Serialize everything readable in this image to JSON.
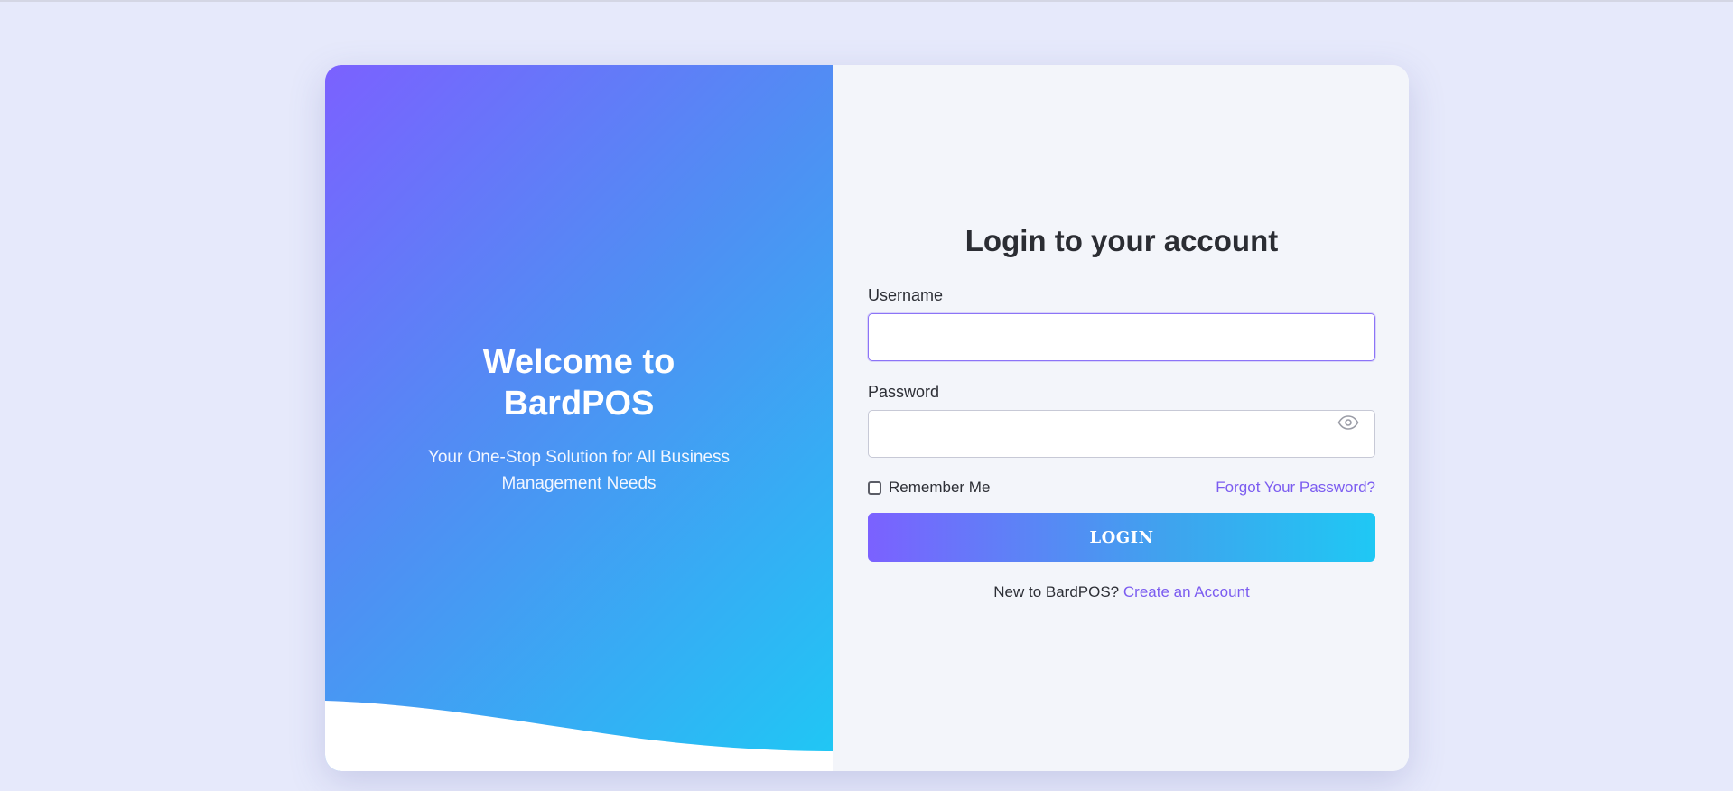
{
  "hero": {
    "title": "Welcome to BardPOS",
    "subtitle": "Your One-Stop Solution for All Business Management Needs"
  },
  "form": {
    "title": "Login to your account",
    "username_label": "Username",
    "username_value": "",
    "password_label": "Password",
    "password_value": "",
    "remember_label": "Remember Me",
    "remember_checked": false,
    "forgot_link": "Forgot Your Password?",
    "login_button": "LOGIN",
    "signup_prompt": "New to BardPOS?",
    "signup_link": "Create an Account"
  },
  "icons": {
    "password_toggle": "eye-icon"
  },
  "colors": {
    "page_background": "#e6e9fb",
    "gradient_start": "#7b61ff",
    "gradient_end": "#1fc8f4",
    "link": "#7b5cf0",
    "focus_border": "#8c74f7"
  }
}
